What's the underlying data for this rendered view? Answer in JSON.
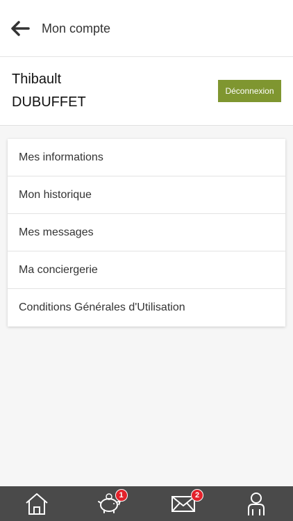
{
  "header": {
    "title": "Mon compte",
    "back_icon": "arrow-left-icon"
  },
  "user": {
    "first_name": "Thibault",
    "last_name": "DUBUFFET",
    "logout_label": "Déconnexion"
  },
  "menu": {
    "items": [
      {
        "label": "Mes informations"
      },
      {
        "label": "Mon historique"
      },
      {
        "label": "Mes messages"
      },
      {
        "label": "Ma conciergerie"
      },
      {
        "label": "Conditions Générales d'Utilisation"
      }
    ]
  },
  "tabbar": {
    "tabs": [
      {
        "icon": "home-icon"
      },
      {
        "icon": "piggy-bank-icon",
        "badge": "1"
      },
      {
        "icon": "envelope-icon",
        "badge": "2"
      },
      {
        "icon": "user-icon"
      }
    ]
  },
  "colors": {
    "accent": "#7f9630",
    "badge": "#e3222b",
    "tabbar": "#4a4a4a"
  }
}
